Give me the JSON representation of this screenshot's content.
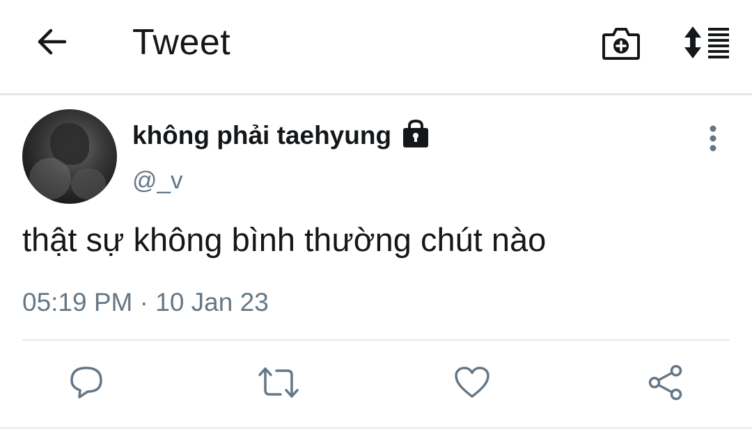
{
  "header": {
    "title": "Tweet",
    "back_icon": "arrow-left-icon",
    "camera_icon": "camera-plus-icon",
    "sort_icon": "sort-list-icon"
  },
  "tweet": {
    "display_name": "không phải taehyung",
    "protected_icon": "lock-icon",
    "handle": "@_v",
    "text": "thật sự không bình thường chút nào",
    "timestamp": "05:19 PM · 10 Jan 23",
    "more_icon": "more-vertical-icon"
  },
  "actions": [
    {
      "name": "reply",
      "icon": "reply-icon"
    },
    {
      "name": "retweet",
      "icon": "retweet-icon"
    },
    {
      "name": "like",
      "icon": "heart-icon"
    },
    {
      "name": "share",
      "icon": "share-icon"
    }
  ],
  "colors": {
    "text_primary": "#14171a",
    "text_secondary": "#657786",
    "icon_muted": "#657786",
    "divider": "#e3e5e8"
  }
}
